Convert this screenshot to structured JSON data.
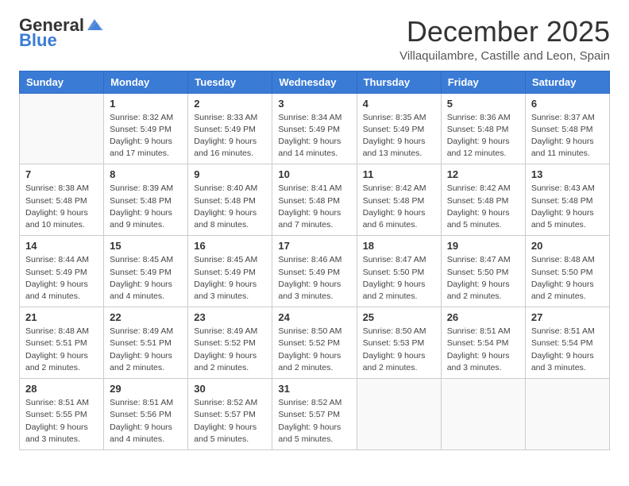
{
  "logo": {
    "general": "General",
    "blue": "Blue"
  },
  "title": "December 2025",
  "subtitle": "Villaquilambre, Castille and Leon, Spain",
  "header": {
    "days": [
      "Sunday",
      "Monday",
      "Tuesday",
      "Wednesday",
      "Thursday",
      "Friday",
      "Saturday"
    ]
  },
  "weeks": [
    [
      {
        "day": "",
        "info": ""
      },
      {
        "day": "1",
        "info": "Sunrise: 8:32 AM\nSunset: 5:49 PM\nDaylight: 9 hours\nand 17 minutes."
      },
      {
        "day": "2",
        "info": "Sunrise: 8:33 AM\nSunset: 5:49 PM\nDaylight: 9 hours\nand 16 minutes."
      },
      {
        "day": "3",
        "info": "Sunrise: 8:34 AM\nSunset: 5:49 PM\nDaylight: 9 hours\nand 14 minutes."
      },
      {
        "day": "4",
        "info": "Sunrise: 8:35 AM\nSunset: 5:49 PM\nDaylight: 9 hours\nand 13 minutes."
      },
      {
        "day": "5",
        "info": "Sunrise: 8:36 AM\nSunset: 5:48 PM\nDaylight: 9 hours\nand 12 minutes."
      },
      {
        "day": "6",
        "info": "Sunrise: 8:37 AM\nSunset: 5:48 PM\nDaylight: 9 hours\nand 11 minutes."
      }
    ],
    [
      {
        "day": "7",
        "info": "Sunrise: 8:38 AM\nSunset: 5:48 PM\nDaylight: 9 hours\nand 10 minutes."
      },
      {
        "day": "8",
        "info": "Sunrise: 8:39 AM\nSunset: 5:48 PM\nDaylight: 9 hours\nand 9 minutes."
      },
      {
        "day": "9",
        "info": "Sunrise: 8:40 AM\nSunset: 5:48 PM\nDaylight: 9 hours\nand 8 minutes."
      },
      {
        "day": "10",
        "info": "Sunrise: 8:41 AM\nSunset: 5:48 PM\nDaylight: 9 hours\nand 7 minutes."
      },
      {
        "day": "11",
        "info": "Sunrise: 8:42 AM\nSunset: 5:48 PM\nDaylight: 9 hours\nand 6 minutes."
      },
      {
        "day": "12",
        "info": "Sunrise: 8:42 AM\nSunset: 5:48 PM\nDaylight: 9 hours\nand 5 minutes."
      },
      {
        "day": "13",
        "info": "Sunrise: 8:43 AM\nSunset: 5:48 PM\nDaylight: 9 hours\nand 5 minutes."
      }
    ],
    [
      {
        "day": "14",
        "info": "Sunrise: 8:44 AM\nSunset: 5:49 PM\nDaylight: 9 hours\nand 4 minutes."
      },
      {
        "day": "15",
        "info": "Sunrise: 8:45 AM\nSunset: 5:49 PM\nDaylight: 9 hours\nand 4 minutes."
      },
      {
        "day": "16",
        "info": "Sunrise: 8:45 AM\nSunset: 5:49 PM\nDaylight: 9 hours\nand 3 minutes."
      },
      {
        "day": "17",
        "info": "Sunrise: 8:46 AM\nSunset: 5:49 PM\nDaylight: 9 hours\nand 3 minutes."
      },
      {
        "day": "18",
        "info": "Sunrise: 8:47 AM\nSunset: 5:50 PM\nDaylight: 9 hours\nand 2 minutes."
      },
      {
        "day": "19",
        "info": "Sunrise: 8:47 AM\nSunset: 5:50 PM\nDaylight: 9 hours\nand 2 minutes."
      },
      {
        "day": "20",
        "info": "Sunrise: 8:48 AM\nSunset: 5:50 PM\nDaylight: 9 hours\nand 2 minutes."
      }
    ],
    [
      {
        "day": "21",
        "info": "Sunrise: 8:48 AM\nSunset: 5:51 PM\nDaylight: 9 hours\nand 2 minutes."
      },
      {
        "day": "22",
        "info": "Sunrise: 8:49 AM\nSunset: 5:51 PM\nDaylight: 9 hours\nand 2 minutes."
      },
      {
        "day": "23",
        "info": "Sunrise: 8:49 AM\nSunset: 5:52 PM\nDaylight: 9 hours\nand 2 minutes."
      },
      {
        "day": "24",
        "info": "Sunrise: 8:50 AM\nSunset: 5:52 PM\nDaylight: 9 hours\nand 2 minutes."
      },
      {
        "day": "25",
        "info": "Sunrise: 8:50 AM\nSunset: 5:53 PM\nDaylight: 9 hours\nand 2 minutes."
      },
      {
        "day": "26",
        "info": "Sunrise: 8:51 AM\nSunset: 5:54 PM\nDaylight: 9 hours\nand 3 minutes."
      },
      {
        "day": "27",
        "info": "Sunrise: 8:51 AM\nSunset: 5:54 PM\nDaylight: 9 hours\nand 3 minutes."
      }
    ],
    [
      {
        "day": "28",
        "info": "Sunrise: 8:51 AM\nSunset: 5:55 PM\nDaylight: 9 hours\nand 3 minutes."
      },
      {
        "day": "29",
        "info": "Sunrise: 8:51 AM\nSunset: 5:56 PM\nDaylight: 9 hours\nand 4 minutes."
      },
      {
        "day": "30",
        "info": "Sunrise: 8:52 AM\nSunset: 5:57 PM\nDaylight: 9 hours\nand 5 minutes."
      },
      {
        "day": "31",
        "info": "Sunrise: 8:52 AM\nSunset: 5:57 PM\nDaylight: 9 hours\nand 5 minutes."
      },
      {
        "day": "",
        "info": ""
      },
      {
        "day": "",
        "info": ""
      },
      {
        "day": "",
        "info": ""
      }
    ]
  ]
}
